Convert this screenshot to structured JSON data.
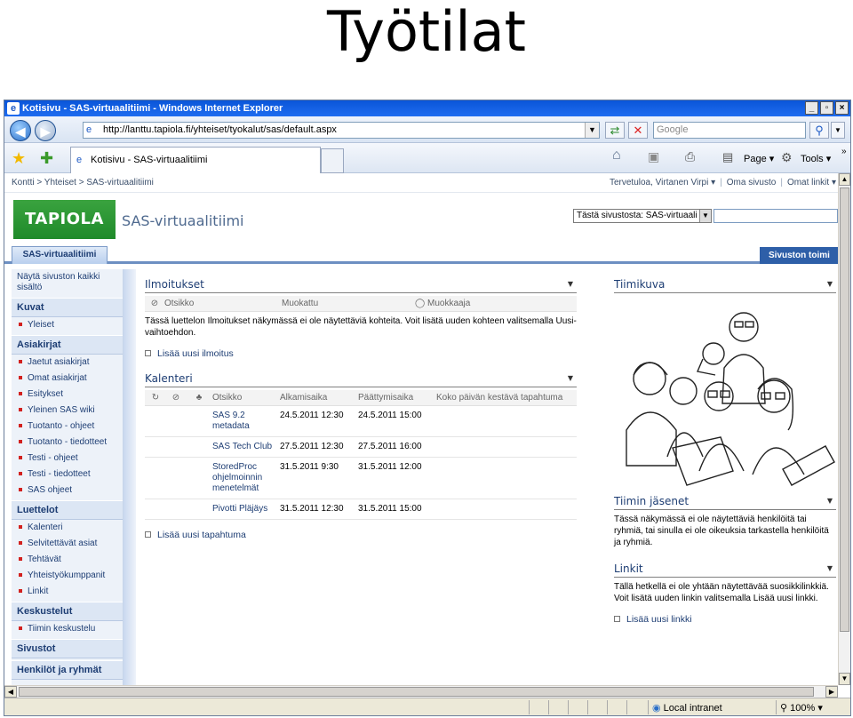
{
  "slide_title": "Työtilat",
  "window": {
    "title": "Kotisivu - SAS-virtuaalitiimi - Windows Internet Explorer",
    "controls": [
      "_",
      "▫",
      "×"
    ]
  },
  "address": {
    "url": "http://lanttu.tapiola.fi/yhteiset/tyokalut/sas/default.aspx",
    "search_placeholder": "Google"
  },
  "tab": {
    "label": "Kotisivu - SAS-virtuaalitiimi"
  },
  "commands": {
    "page": "Page",
    "tools": "Tools"
  },
  "topnav": {
    "breadcrumb": "Kontti > Yhteiset > SAS-virtuaalitiimi",
    "welcome": "Tervetuloa, Virtanen Virpi",
    "my_site": "Oma sivusto",
    "my_links": "Omat linkit"
  },
  "site": {
    "logo": "TAPIOLA",
    "title": "SAS-virtuaalitiimi",
    "scope": "Tästä sivustosta: SAS-virtuaali",
    "active_tab": "SAS-virtuaalitiimi",
    "site_actions": "Sivuston toimi"
  },
  "quicklaunch": {
    "view_all": "Näytä sivuston kaikki sisältö",
    "sections": [
      {
        "title": "Kuvat",
        "items": [
          "Yleiset"
        ]
      },
      {
        "title": "Asiakirjat",
        "items": [
          "Jaetut asiakirjat",
          "Omat asiakirjat",
          "Esitykset",
          "Yleinen SAS wiki",
          "Tuotanto - ohjeet",
          "Tuotanto - tiedotteet",
          "Testi - ohjeet",
          "Testi - tiedotteet",
          "SAS ohjeet"
        ]
      },
      {
        "title": "Luettelot",
        "items": [
          "Kalenteri",
          "Selvitettävät asiat",
          "Tehtävät",
          "Yhteistyökumppanit",
          "Linkit"
        ]
      },
      {
        "title": "Keskustelut",
        "items": [
          "Tiimin keskustelu"
        ]
      },
      {
        "title": "Sivustot",
        "items": []
      },
      {
        "title": "Henkilöt ja ryhmät",
        "items": []
      }
    ]
  },
  "announcements": {
    "title": "Ilmoitukset",
    "columns": [
      "Otsikko",
      "Muokattu",
      "Muokkaaja"
    ],
    "empty_text": "Tässä luettelon Ilmoitukset näkymässä ei ole näytettäviä kohteita. Voit lisätä uuden kohteen valitsemalla Uusi-vaihtoehdon.",
    "add_link": "Lisää uusi ilmoitus"
  },
  "calendar": {
    "title": "Kalenteri",
    "columns": [
      "Otsikko",
      "Alkamisaika",
      "Päättymisaika",
      "Koko päivän kestävä tapahtuma"
    ],
    "rows": [
      {
        "title": "SAS 9.2 metadata",
        "start": "24.5.2011 12:30",
        "end": "24.5.2011 15:00"
      },
      {
        "title": "SAS Tech Club",
        "start": "27.5.2011 12:30",
        "end": "27.5.2011 16:00"
      },
      {
        "title": "StoredProc ohjelmoinnin menetelmät",
        "start": "31.5.2011 9:30",
        "end": "31.5.2011 12:00"
      },
      {
        "title": "Pivotti Pläjäys",
        "start": "31.5.2011 12:30",
        "end": "31.5.2011 15:00"
      }
    ],
    "add_link": "Lisää uusi tapahtuma"
  },
  "team_image": {
    "title": "Tiimikuva"
  },
  "members": {
    "title": "Tiimin jäsenet",
    "text": "Tässä näkymässä ei ole näytettäviä henkilöitä tai ryhmiä, tai sinulla ei ole oikeuksia tarkastella henkilöitä ja ryhmiä."
  },
  "links": {
    "title": "Linkit",
    "text": "Tällä hetkellä ei ole yhtään näytettävää suosikkilinkkiä. Voit lisätä uuden linkin valitsemalla Lisää uusi linkki.",
    "add_link": "Lisää uusi linkki"
  },
  "statusbar": {
    "zone": "Local intranet",
    "zoom": "100%"
  }
}
